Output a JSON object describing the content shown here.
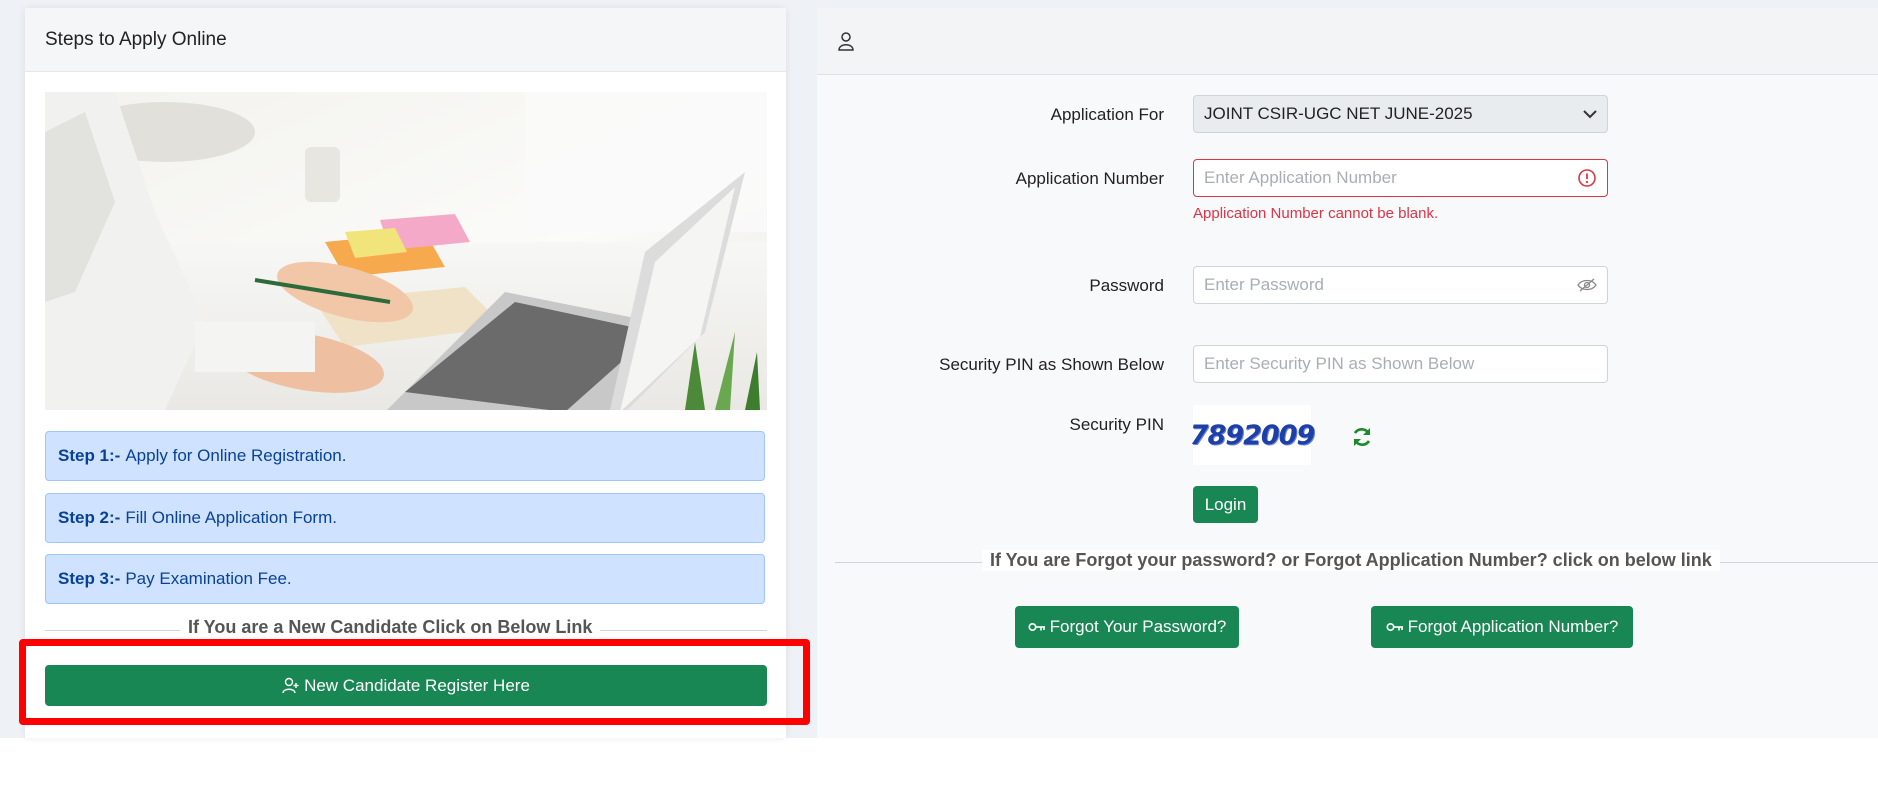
{
  "left_panel": {
    "title": "Steps to Apply Online",
    "steps": [
      {
        "label": "Step 1:-",
        "text": "Apply for Online Registration."
      },
      {
        "label": "Step 2:-",
        "text": "Fill Online Application Form."
      },
      {
        "label": "Step 3:-",
        "text": "Pay Examination Fee."
      }
    ],
    "new_candidate_text": "If You are a New Candidate Click on Below Link",
    "register_button": "New Candidate Register Here"
  },
  "login_form": {
    "header_icon": "user-icon",
    "application_for": {
      "label": "Application For",
      "value": "JOINT CSIR-UGC NET JUNE-2025"
    },
    "application_number": {
      "label": "Application Number",
      "placeholder": "Enter Application Number",
      "error": "Application Number cannot be blank."
    },
    "password": {
      "label": "Password",
      "placeholder": "Enter Password"
    },
    "security_pin_input": {
      "label": "Security PIN as Shown Below",
      "placeholder": "Enter Security PIN as Shown Below"
    },
    "security_pin": {
      "label": "Security PIN",
      "captcha": "7892009"
    },
    "login_button": "Login",
    "forgot_text": "If You are Forgot your password? or Forgot Application Number? click on below link",
    "forgot_password_button": "Forgot Your Password?",
    "forgot_appno_button": "Forgot Application Number?"
  },
  "colors": {
    "primary_green": "#198754",
    "step_bg": "#cfe2ff",
    "error_red": "#dc3545",
    "highlight_red": "#ff0000"
  }
}
